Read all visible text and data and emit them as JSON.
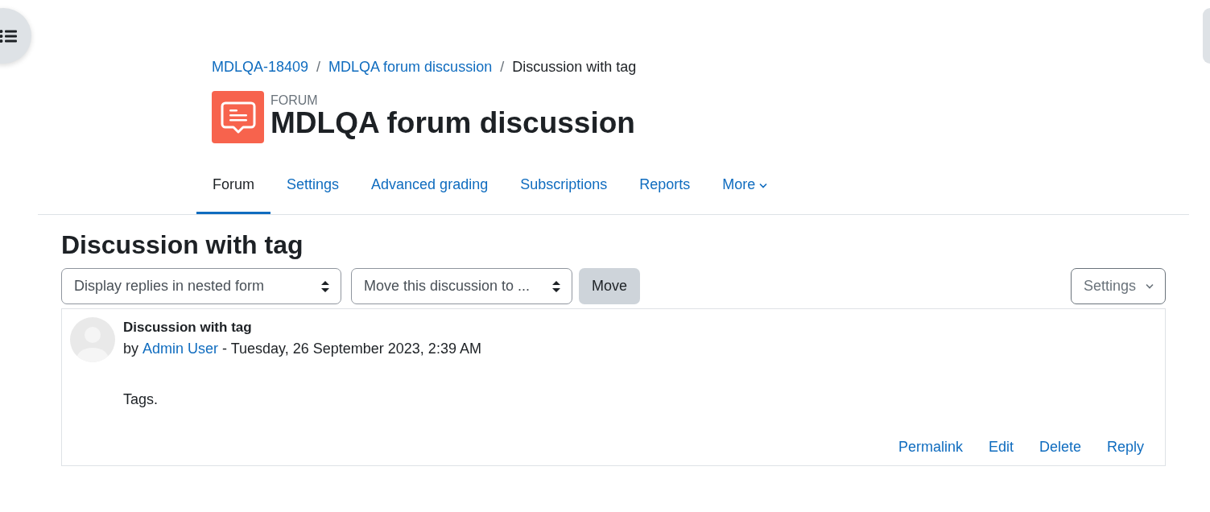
{
  "breadcrumb": [
    {
      "label": "MDLQA-18409",
      "link": true,
      "separator": "/"
    },
    {
      "label": "MDLQA forum discussion",
      "link": true,
      "separator": "/"
    },
    {
      "label": "Discussion with tag",
      "link": false
    }
  ],
  "activity": {
    "type_label": "FORUM",
    "title": "MDLQA forum discussion"
  },
  "tabs": [
    {
      "label": "Forum",
      "selected": true,
      "dropdown": false
    },
    {
      "label": "Settings",
      "selected": false,
      "dropdown": false
    },
    {
      "label": "Advanced grading",
      "selected": false,
      "dropdown": false
    },
    {
      "label": "Subscriptions",
      "selected": false,
      "dropdown": false
    },
    {
      "label": "Reports",
      "selected": false,
      "dropdown": false
    },
    {
      "label": "More",
      "selected": false,
      "dropdown": true
    }
  ],
  "discussion": {
    "title": "Discussion with tag",
    "display_select": {
      "value": "Display replies in nested form"
    },
    "move_select": {
      "value": "Move this discussion to ..."
    },
    "move_button": "Move",
    "settings_button": "Settings",
    "post": {
      "subject": "Discussion with tag",
      "by": "by",
      "author": "Admin User",
      "date": "- Tuesday, 26 September 2023, 2:39 AM",
      "body": "Tags.",
      "actions": [
        "Permalink",
        "Edit",
        "Delete",
        "Reply"
      ]
    }
  }
}
